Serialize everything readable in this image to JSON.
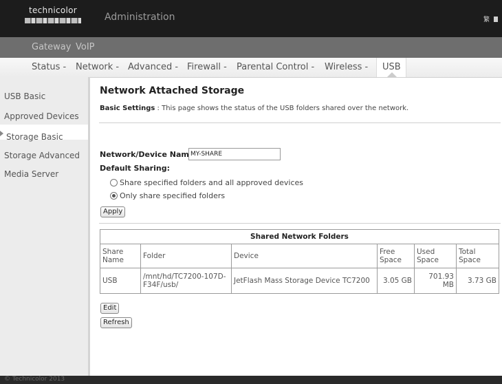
{
  "header": {
    "logo_text": "technicolor",
    "title": "Administration",
    "lang_label": "繁"
  },
  "nav_primary": [
    "Gateway",
    "VoIP"
  ],
  "nav_secondary": [
    "Status -",
    "Network -",
    "Advanced -",
    "Firewall -",
    "Parental Control -",
    "Wireless -"
  ],
  "nav_secondary_active": "USB",
  "sidebar": {
    "items": [
      "USB Basic",
      "Approved Devices",
      "Storage Basic",
      "Storage Advanced",
      "Media Server"
    ],
    "selected_index": 2
  },
  "page": {
    "title": "Network Attached Storage",
    "basic_settings_label": "Basic Settings",
    "basic_settings_desc": " : This page shows the status of the USB folders shared over the network.",
    "device_name_label": "Network/Device Name:",
    "device_name_value": "MY-SHARE",
    "default_sharing_label": "Default Sharing:",
    "radio_options": [
      "Share specified folders and all approved devices",
      "Only share specified folders"
    ],
    "radio_selected": 1,
    "apply_label": "Apply",
    "edit_label": "Edit",
    "refresh_label": "Refresh"
  },
  "table": {
    "caption": "Shared Network Folders",
    "headers": [
      "Share Name",
      "Folder",
      "Device",
      "Free Space",
      "Used Space",
      "Total Space"
    ],
    "rows": [
      [
        "USB",
        "/mnt/hd/TC7200-107D-F34F/usb/",
        "JetFlash Mass Storage Device TC7200",
        "3.05 GB",
        "701.93 MB",
        "3.73 GB"
      ]
    ]
  },
  "footer": {
    "text": "© Technicolor 2013"
  }
}
